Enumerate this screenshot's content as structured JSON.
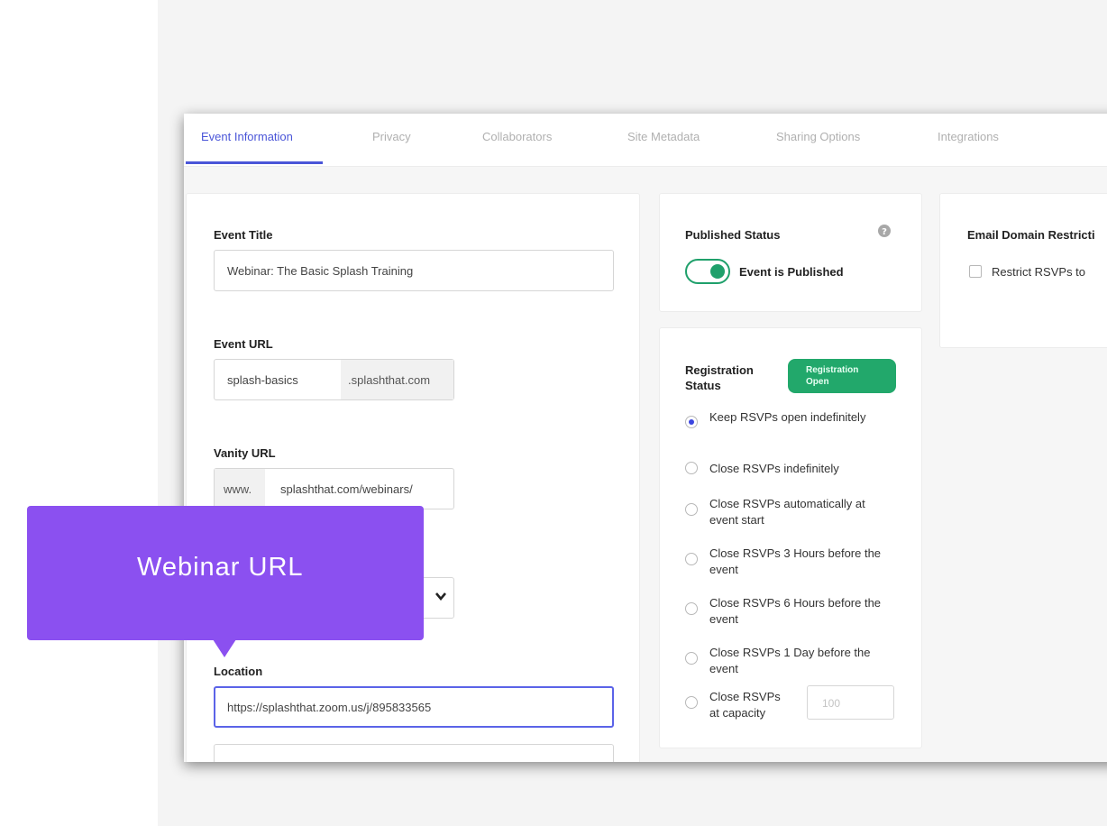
{
  "tabs": [
    {
      "label": "Event Information",
      "active": true
    },
    {
      "label": "Privacy"
    },
    {
      "label": "Collaborators"
    },
    {
      "label": "Site Metadata"
    },
    {
      "label": "Sharing Options"
    },
    {
      "label": "Integrations"
    }
  ],
  "event_title": {
    "label": "Event Title",
    "value": "Webinar: The Basic Splash Training"
  },
  "event_url": {
    "label": "Event URL",
    "value": "splash-basics",
    "suffix": ".splashthat.com"
  },
  "vanity_url": {
    "label": "Vanity URL",
    "prefix": "www.",
    "value": "splashthat.com/webinars/"
  },
  "location": {
    "label": "Location",
    "value": "https://splashthat.zoom.us/j/895833565"
  },
  "published": {
    "label": "Published Status",
    "toggle_label": "Event is Published",
    "toggle_on": true
  },
  "registration": {
    "label": "Registration Status",
    "badge": "Registration Open",
    "options": [
      {
        "label": "Keep RSVPs open indefinitely",
        "selected": true
      },
      {
        "label": "Close RSVPs indefinitely"
      },
      {
        "label": "Close RSVPs automatically at event start"
      },
      {
        "label": "Close RSVPs 3 Hours before the event"
      },
      {
        "label": "Close RSVPs 6 Hours before the event"
      },
      {
        "label": "Close RSVPs 1 Day before the event"
      },
      {
        "label": "Close RSVPs at capacity"
      }
    ],
    "capacity_placeholder": "100"
  },
  "email_domain": {
    "label": "Email Domain Restricti",
    "checkbox_label": "Restrict RSVPs to"
  },
  "tooltip": {
    "text": "Webinar URL"
  },
  "colors": {
    "accent": "#4a55d8",
    "toggle": "#1fa06b",
    "badge": "#22a86b",
    "tooltip": "#8b50f0"
  },
  "icons": [
    "help-icon",
    "chevron-down-icon"
  ]
}
